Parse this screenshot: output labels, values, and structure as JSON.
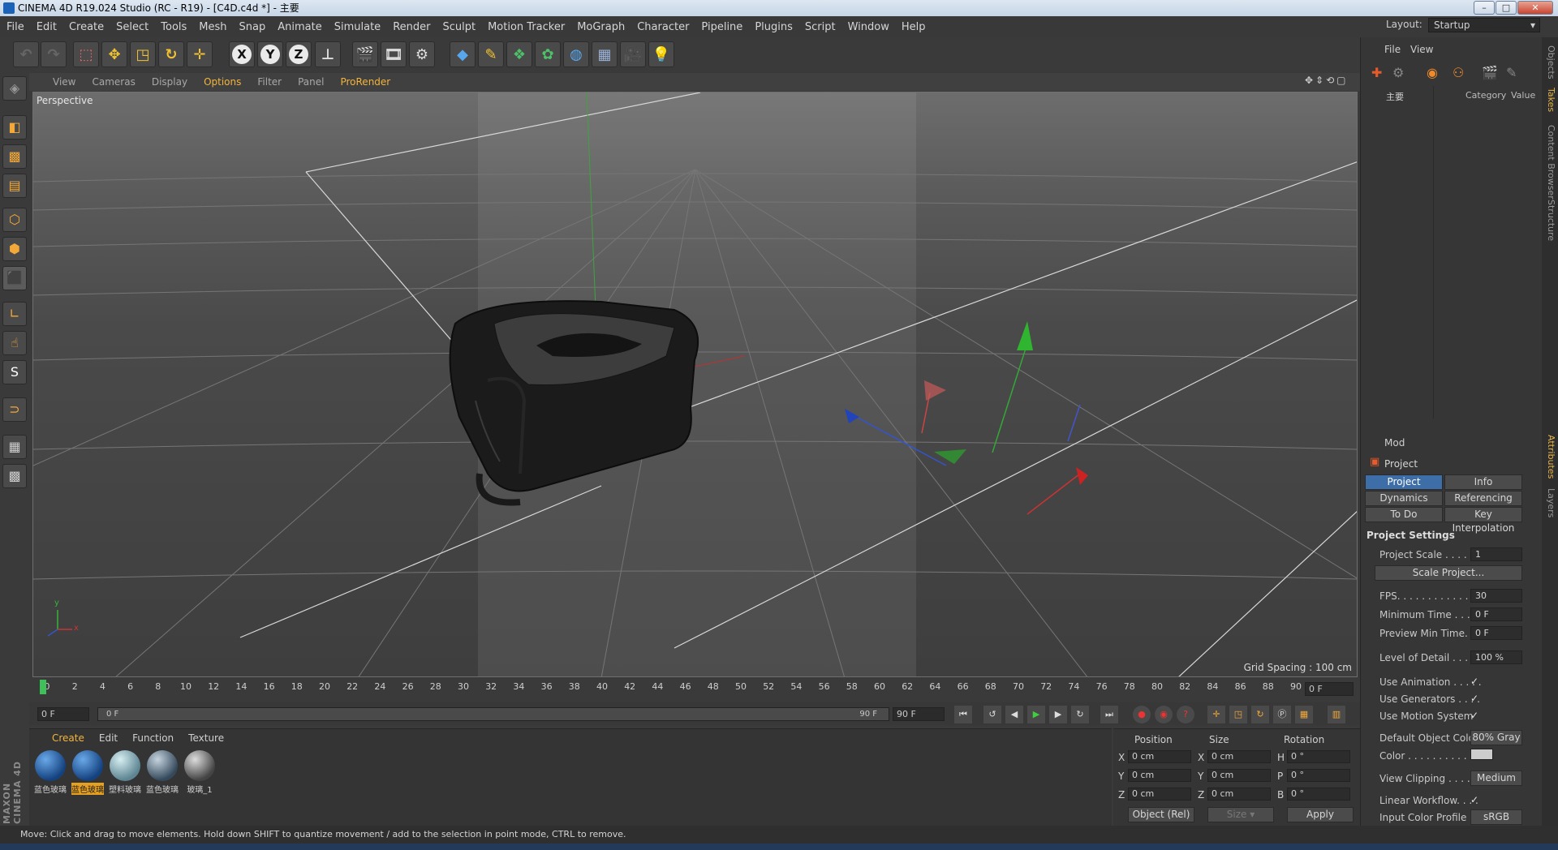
{
  "window": {
    "title": "CINEMA 4D R19.024 Studio (RC - R19) - [C4D.c4d *] - 主要"
  },
  "menu": [
    "File",
    "Edit",
    "Create",
    "Select",
    "Tools",
    "Mesh",
    "Snap",
    "Animate",
    "Simulate",
    "Render",
    "Sculpt",
    "Motion Tracker",
    "MoGraph",
    "Character",
    "Pipeline",
    "Plugins",
    "Script",
    "Window",
    "Help"
  ],
  "layout": {
    "label": "Layout:",
    "value": "Startup"
  },
  "toolbar": {
    "axis_x": "X",
    "axis_y": "Y",
    "axis_z": "Z"
  },
  "left_toolbar": {
    "s_label": "S"
  },
  "viewport_menu": [
    "View",
    "Cameras",
    "Display",
    "Options",
    "Filter",
    "Panel",
    "ProRender"
  ],
  "viewport": {
    "label": "Perspective",
    "grid_info": "Grid Spacing : 100 cm",
    "axis_y": "y",
    "axis_x": "x"
  },
  "objects_panel": {
    "menu_file": "File",
    "menu_view": "View",
    "take_name": "主要",
    "col_category": "Category",
    "col_value": "Value"
  },
  "attributes": {
    "mode": "Mod",
    "title": "Project",
    "tabs": [
      "Project Settings",
      "Info",
      "Dynamics",
      "Referencing",
      "To Do",
      "Key Interpolation"
    ],
    "section": "Project Settings",
    "project_scale_label": "Project Scale . . . . . .",
    "project_scale": "1",
    "scale_project_button": "Scale Project...",
    "fps_label": "FPS. . . . . . . . . . . . . .",
    "fps": "30",
    "min_time_label": "Minimum Time . . . . .",
    "min_time": "0 F",
    "preview_min_label": "Preview Min Time. . .",
    "preview_min": "0 F",
    "lod_label": "Level of Detail . . . . .",
    "lod": "100 %",
    "use_animation_label": "Use Animation . . . . .",
    "use_generators_label": "Use Generators . . . .",
    "use_motion_label": "Use Motion System",
    "check": "✓",
    "default_color_label": "Default Object Color",
    "default_color": "80% Gray",
    "color_label": "Color . . . . . . . . . .",
    "view_clipping_label": "View Clipping . . . . .",
    "view_clipping": "Medium",
    "linear_workflow_label": "Linear Workflow. . . .",
    "input_color_label": "Input Color Profile . .",
    "input_color": "sRGB"
  },
  "right_tabs": [
    "Objects",
    "Takes",
    "Content Browser",
    "Structure",
    "Attributes",
    "Layers"
  ],
  "timeline": {
    "ticks": [
      "0",
      "2",
      "4",
      "6",
      "8",
      "10",
      "12",
      "14",
      "16",
      "18",
      "20",
      "22",
      "24",
      "26",
      "28",
      "30",
      "32",
      "34",
      "36",
      "38",
      "40",
      "42",
      "44",
      "46",
      "48",
      "50",
      "52",
      "54",
      "56",
      "58",
      "60",
      "62",
      "64",
      "66",
      "68",
      "70",
      "72",
      "74",
      "76",
      "78",
      "80",
      "82",
      "84",
      "86",
      "88",
      "90"
    ],
    "current_frame": "0 F",
    "start": "0 F",
    "range_start": "0 F",
    "range_end": "90 F",
    "end": "90 F"
  },
  "materials": {
    "menu": [
      "Create",
      "Edit",
      "Function",
      "Texture"
    ],
    "items": [
      {
        "label": "蓝色玻璃",
        "color": "#1f5da6"
      },
      {
        "label": "蓝色玻璃",
        "color": "#1f5da6"
      },
      {
        "label": "塑料玻璃",
        "color": "#8fb3bf"
      },
      {
        "label": "蓝色玻璃",
        "color": "#6c7f8c"
      },
      {
        "label": "玻璃_1",
        "color": "#7a7a7a"
      }
    ]
  },
  "coordinates": {
    "position": "Position",
    "size": "Size",
    "rotation": "Rotation",
    "rows": [
      {
        "axis": "X",
        "pos": "0 cm",
        "size_axis": "X",
        "size": "0 cm",
        "rot_axis": "H",
        "rot": "0 °"
      },
      {
        "axis": "Y",
        "pos": "0 cm",
        "size_axis": "Y",
        "size": "0 cm",
        "rot_axis": "P",
        "rot": "0 °"
      },
      {
        "axis": "Z",
        "pos": "0 cm",
        "size_axis": "Z",
        "size": "0 cm",
        "rot_axis": "B",
        "rot": "0 °"
      }
    ],
    "mode": "Object (Rel)",
    "size_mode": "Size",
    "apply": "Apply"
  },
  "branding": "MAXON CINEMA 4D",
  "status": "Move: Click and drag to move elements. Hold down SHIFT to quantize movement / add to the selection in point mode, CTRL to remove."
}
